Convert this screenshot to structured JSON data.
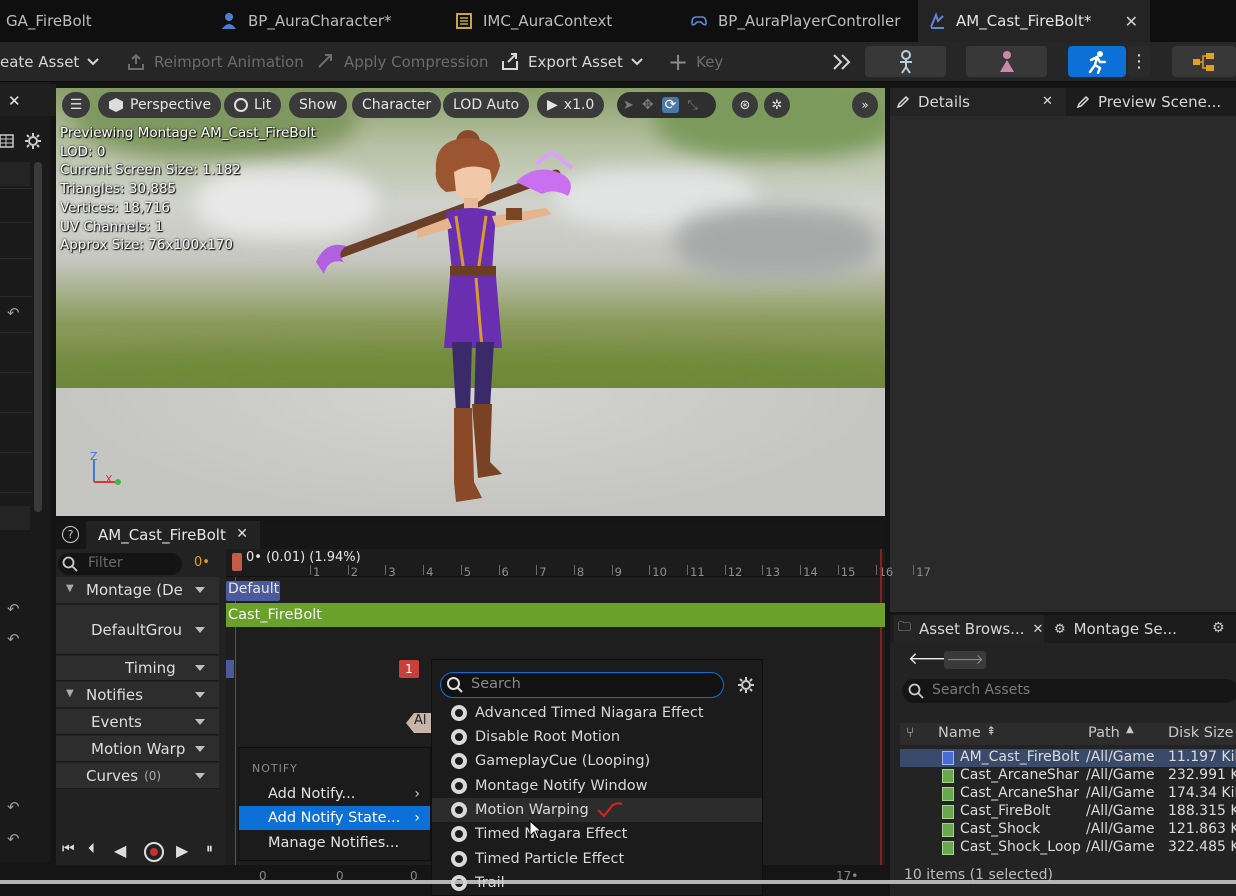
{
  "tabs": [
    {
      "label": "GA_FireBolt",
      "icon": "gameplay-ability-icon",
      "active": false
    },
    {
      "label": "BP_AuraCharacter*",
      "icon": "character-icon",
      "active": false
    },
    {
      "label": "IMC_AuraContext",
      "icon": "input-mapping-icon",
      "active": false
    },
    {
      "label": "BP_AuraPlayerController",
      "icon": "gamepad-icon",
      "active": false
    },
    {
      "label": "AM_Cast_FireBolt*",
      "icon": "anim-montage-icon",
      "active": true
    }
  ],
  "toolbar": {
    "create_asset": "eate Asset",
    "reimport": "Reimport Animation",
    "apply_compression": "Apply Compression",
    "export_asset": "Export Asset",
    "key": "Key"
  },
  "viewport": {
    "perspective": "Perspective",
    "lit": "Lit",
    "show": "Show",
    "character": "Character",
    "lod": "LOD Auto",
    "speed": "x1.0",
    "stats": [
      "Previewing Montage AM_Cast_FireBolt",
      "LOD: 0",
      "Current Screen Size: 1.182",
      "Triangles: 30,885",
      "Vertices: 18,716",
      "UV Channels: 1",
      "Approx Size: 76x100x170"
    ],
    "axis_z": "Z",
    "axis_x": "X"
  },
  "details": {
    "tab_details": "Details",
    "tab_preview": "Preview Scene..."
  },
  "montage": {
    "tab_label": "AM_Cast_FireBolt",
    "filter_placeholder": "Filter",
    "filter_counter": "0•",
    "playhead_label": "0• (0.01) (1.94%)",
    "ruler": [
      "1",
      "2",
      "3",
      "4",
      "5",
      "6",
      "7",
      "8",
      "9",
      "10",
      "11",
      "12",
      "13",
      "14",
      "15",
      "16",
      "17"
    ],
    "tracks": {
      "montage": "Montage (De",
      "default_group": "DefaultGrou",
      "timing": "Timing",
      "notifies": "Notifies",
      "events": "Events",
      "motion_warp": "Motion Warp",
      "curves": "Curves",
      "curves_count": "(0)"
    },
    "section_default": "Default",
    "segment_name": "Cast_FireBolt",
    "timing_marker": "1",
    "notify_fragment": "Al",
    "bottom_numbers": [
      "0",
      "0",
      "0",
      "17•"
    ]
  },
  "notify_menu": {
    "header": "NOTIFY",
    "items": [
      "Add Notify...",
      "Add Notify State...",
      "Manage Notifies..."
    ]
  },
  "state_menu": {
    "search_placeholder": "Search",
    "items": [
      "Advanced Timed Niagara Effect",
      "Disable Root Motion",
      "GameplayCue (Looping)",
      "Montage Notify Window",
      "Motion Warping",
      "Timed Niagara Effect",
      "Timed Particle Effect",
      "Trail"
    ]
  },
  "asset_browser": {
    "tab_asset": "Asset Brows...",
    "tab_montage": "Montage Se...",
    "search_placeholder": "Search Assets",
    "columns": [
      "Name",
      "Path",
      "Disk Size"
    ],
    "rows": [
      {
        "name": "AM_Cast_FireBolt",
        "path": "/All/Game",
        "size": "11.197 Kil"
      },
      {
        "name": "Cast_ArcaneShar",
        "path": "/All/Game",
        "size": "232.991 K"
      },
      {
        "name": "Cast_ArcaneShar",
        "path": "/All/Game",
        "size": "174.34 Kil"
      },
      {
        "name": "Cast_FireBolt",
        "path": "/All/Game",
        "size": "188.315 K"
      },
      {
        "name": "Cast_Shock",
        "path": "/All/Game",
        "size": "121.863 K"
      },
      {
        "name": "Cast_Shock_Loop",
        "path": "/All/Game",
        "size": "322.485 K"
      }
    ],
    "status": "10 items (1 selected)"
  },
  "colors": {
    "accent_blue": "#0c70d6",
    "montage_green": "#6aa12a",
    "section_blue": "#4a5a9a",
    "timing_red": "#c9403a"
  }
}
